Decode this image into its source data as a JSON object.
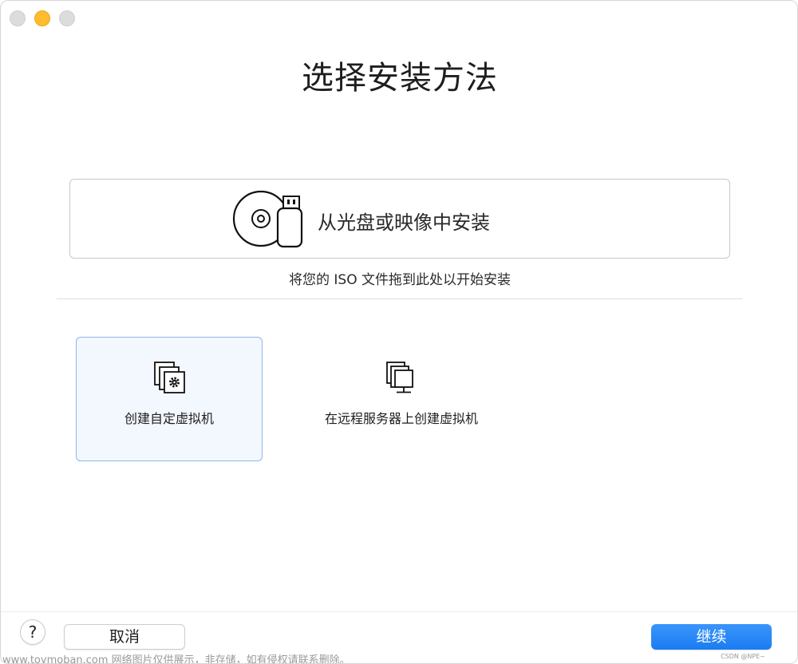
{
  "window": {
    "controls": [
      "close",
      "minimize",
      "maximize"
    ],
    "accent_color": "#1a7cf2"
  },
  "header": {
    "title": "选择安装方法"
  },
  "install_option": {
    "label": "从光盘或映像中安装",
    "icon": "disc-usb-icon",
    "hint": "将您的 ISO 文件拖到此处以开始安装"
  },
  "options": [
    {
      "label": "创建自定虚拟机",
      "icon": "custom-vm-icon",
      "selected": true
    },
    {
      "label": "在远程服务器上创建虚拟机",
      "icon": "remote-server-icon",
      "selected": false
    }
  ],
  "footer": {
    "help_label": "?",
    "cancel_label": "取消",
    "continue_label": "继续"
  },
  "watermark": {
    "text": "www.toymoban.com 网络图片仅供展示，非存储，如有侵权请联系删除。",
    "corner_text": "CSDN @NPE~"
  }
}
